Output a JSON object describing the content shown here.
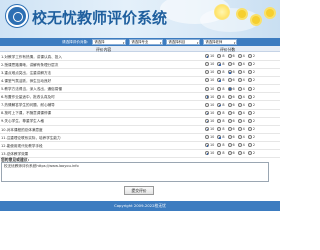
{
  "header": {
    "title": "校无忧教师评价系统"
  },
  "filters": {
    "label": "请选择评价对象:",
    "selects": [
      {
        "name": "class",
        "value": "请选择"
      },
      {
        "name": "major",
        "value": "请选择专业"
      },
      {
        "name": "subject",
        "value": "请选择科目"
      },
      {
        "name": "teacher",
        "value": "请选择老师"
      }
    ]
  },
  "table": {
    "col_content": "评价内容",
    "col_score": "评价分数",
    "rows": [
      {
        "question": "1.对教学工作有热情，讲课认真、投入",
        "selected": 10
      },
      {
        "question": "2.授课思路清晰，讲解有条理分层次",
        "selected": 8
      },
      {
        "question": "3.重点难点突出，注重讲解方法",
        "selected": 6
      },
      {
        "question": "4.课堂气氛活跃，师生互动良好",
        "selected": 8
      },
      {
        "question": "5.教学方法得当，深入浅出，通俗易懂",
        "selected": 6
      },
      {
        "question": "6.布置作业量适中，批改认真及时",
        "selected": 10
      },
      {
        "question": "7.热情解答学生的问题，耐心辅导",
        "selected": 8
      },
      {
        "question": "8.按时上下课，不随意调课停课",
        "selected": 10
      },
      {
        "question": "9.关心学生，尊重学生人格",
        "selected": 10
      },
      {
        "question": "10.对本课程的总体满意度",
        "selected": 10
      },
      {
        "question": "11.注重理论联系实际，培养学生能力",
        "selected": 8
      },
      {
        "question": "12.能使用现代化教学手段",
        "selected": 10
      },
      {
        "question": "13.总体教学效果",
        "selected": 10
      }
    ],
    "options": [
      10,
      8,
      6,
      4,
      2
    ]
  },
  "suggest": {
    "label": "您的意见或建议:",
    "value": "校无忧教师评价系统https://www.laoyou.info"
  },
  "submit_label": "提交评价",
  "footer": {
    "copyright": "Copyright 2009-2022校无忧"
  }
}
